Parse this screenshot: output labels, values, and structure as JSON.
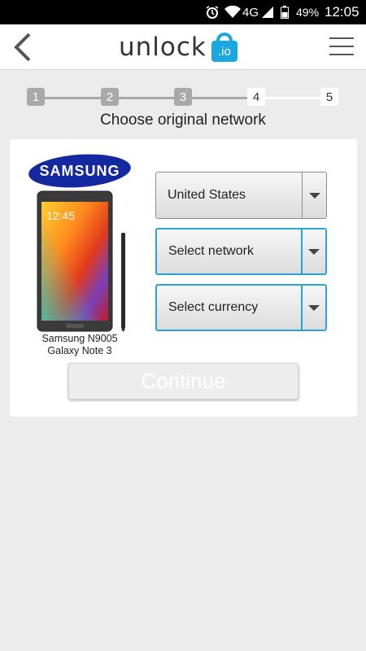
{
  "status_bar": {
    "network_type": "4G",
    "battery_percent": "49%",
    "time": "12:05",
    "icons": [
      "alarm-icon",
      "wifi-icon",
      "signal-icon",
      "battery-icon"
    ]
  },
  "header": {
    "back_icon": "chevron-left-icon",
    "logo_text": "unlock",
    "logo_badge": ".io",
    "menu_icon": "hamburger-menu-icon"
  },
  "stepper": {
    "steps": [
      {
        "label": "1",
        "state": "done"
      },
      {
        "label": "2",
        "state": "done"
      },
      {
        "label": "3",
        "state": "done"
      },
      {
        "label": "4",
        "state": "current"
      },
      {
        "label": "5",
        "state": "todo"
      }
    ],
    "title": "Choose original network"
  },
  "device": {
    "brand_logo_text": "SAMSUNG",
    "model_line1": "Samsung N9005",
    "model_line2": "Galaxy Note 3",
    "screen_time": "12:45"
  },
  "form": {
    "country": {
      "value": "United States"
    },
    "network": {
      "value": "Select network"
    },
    "currency": {
      "value": "Select currency"
    },
    "continue_label": "Continue"
  },
  "colors": {
    "accent": "#2aa3d8",
    "logo_blue": "#1aa7e0",
    "step_done": "#a9a9a9",
    "page_bg": "#ececec"
  }
}
